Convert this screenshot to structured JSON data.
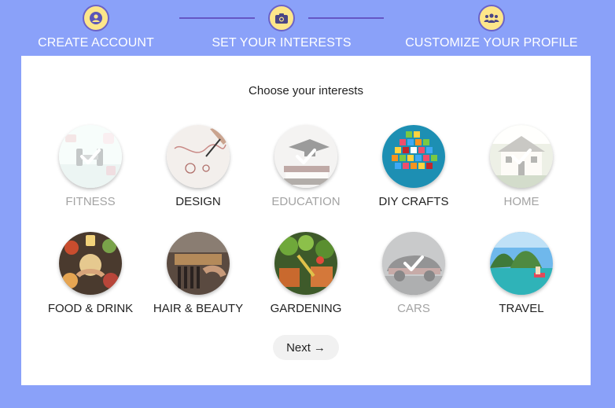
{
  "stepper": {
    "steps": [
      {
        "label": "CREATE ACCOUNT",
        "icon": "user-icon"
      },
      {
        "label": "SET YOUR INTERESTS",
        "icon": "camera-icon"
      },
      {
        "label": "CUSTOMIZE YOUR PROFILE",
        "icon": "users-icon"
      }
    ]
  },
  "main": {
    "title": "Choose your interests",
    "interests": [
      {
        "label": "FITNESS",
        "selected": true
      },
      {
        "label": "DESIGN",
        "selected": false
      },
      {
        "label": "EDUCATION",
        "selected": true
      },
      {
        "label": "DIY CRAFTS",
        "selected": false
      },
      {
        "label": "HOME",
        "selected": true
      },
      {
        "label": "FOOD & DRINK",
        "selected": false
      },
      {
        "label": "HAIR & BEAUTY",
        "selected": false
      },
      {
        "label": "GARDENING",
        "selected": false
      },
      {
        "label": "CARS",
        "selected": true
      },
      {
        "label": "TRAVEL",
        "selected": false
      }
    ],
    "next_label": "Next"
  },
  "colors": {
    "background": "#8aa1f9",
    "step_circle": "#fde68a",
    "connector": "#6557c4",
    "selected_label": "#a3a3a3"
  }
}
